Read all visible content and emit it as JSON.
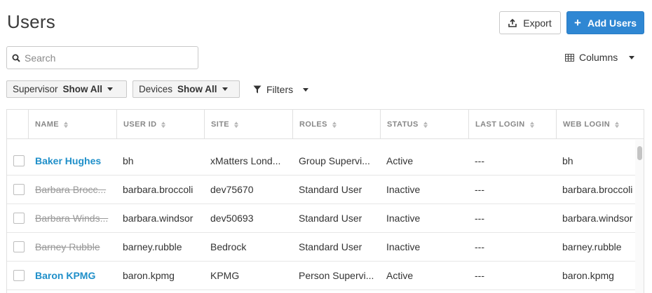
{
  "page": {
    "title": "Users"
  },
  "header": {
    "export_label": "Export",
    "add_users_label": "Add Users"
  },
  "search": {
    "placeholder": "Search"
  },
  "columns_menu": {
    "label": "Columns"
  },
  "filters": {
    "supervisor": {
      "label": "Supervisor",
      "value": "Show All"
    },
    "devices": {
      "label": "Devices",
      "value": "Show All"
    },
    "filters_label": "Filters"
  },
  "table": {
    "headers": [
      "NAME",
      "USER ID",
      "SITE",
      "ROLES",
      "STATUS",
      "LAST LOGIN",
      "WEB LOGIN"
    ],
    "rows": [
      {
        "name": "Baker Hughes",
        "active": true,
        "user_id": "bh",
        "site": "xMatters Lond...",
        "roles": "Group Supervi...",
        "status": "Active",
        "last_login": "---",
        "web_login": "bh"
      },
      {
        "name": "Barbara Brocc...",
        "active": false,
        "user_id": "barbara.broccoli",
        "site": "dev75670",
        "roles": "Standard User",
        "status": "Inactive",
        "last_login": "---",
        "web_login": "barbara.broccoli"
      },
      {
        "name": "Barbara Winds...",
        "active": false,
        "user_id": "barbara.windsor",
        "site": "dev50693",
        "roles": "Standard User",
        "status": "Inactive",
        "last_login": "---",
        "web_login": "barbara.windsor"
      },
      {
        "name": "Barney Rubble",
        "active": false,
        "user_id": "barney.rubble",
        "site": "Bedrock",
        "roles": "Standard User",
        "status": "Inactive",
        "last_login": "---",
        "web_login": "barney.rubble"
      },
      {
        "name": "Baron KPMG",
        "active": true,
        "user_id": "baron.kpmg",
        "site": "KPMG",
        "roles": "Person Supervi...",
        "status": "Active",
        "last_login": "---",
        "web_login": "baron.kpmg"
      }
    ]
  },
  "colors": {
    "accent": "#2f87d3",
    "link": "#1f8fc9",
    "muted": "#9a9a9a"
  }
}
